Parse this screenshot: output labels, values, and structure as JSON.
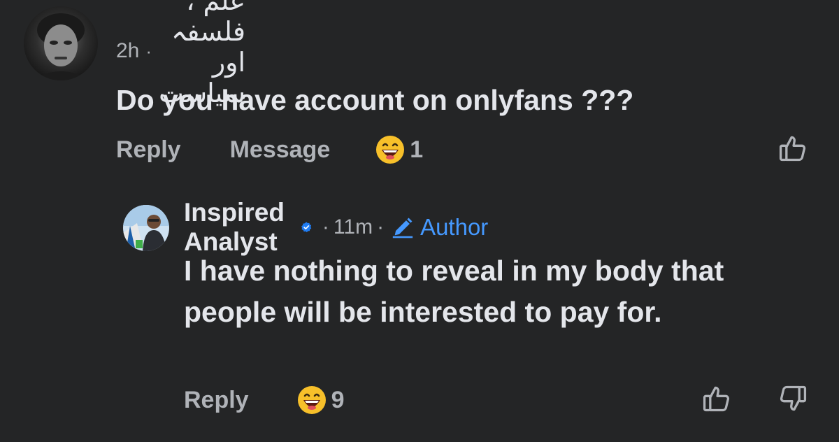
{
  "comment": {
    "time": "2h",
    "separator": "·",
    "username": "علم ، فلسفہ اور سیاست",
    "text": "Do you have account on onlyfans ???",
    "actions": {
      "reply_label": "Reply",
      "message_label": "Message"
    },
    "reaction": {
      "icon": "laughing-face-icon",
      "count": "1"
    },
    "like_icon": "thumbs-up-icon"
  },
  "reply": {
    "username": "Inspired Analyst",
    "verified_icon": "verified-badge-icon",
    "separator": "·",
    "time": "11m",
    "author_label": "Author",
    "author_icon": "pencil-icon",
    "text": "I have nothing to reveal in my body that people will be interested to pay for.",
    "actions": {
      "reply_label": "Reply"
    },
    "reaction": {
      "icon": "laughing-face-icon",
      "count": "9"
    },
    "like_icon": "thumbs-up-icon",
    "dislike_icon": "thumbs-down-icon"
  },
  "colors": {
    "background": "#242526",
    "primary_text": "#e4e6eb",
    "secondary_text": "#b0b3b8",
    "accent": "#4599ff"
  }
}
